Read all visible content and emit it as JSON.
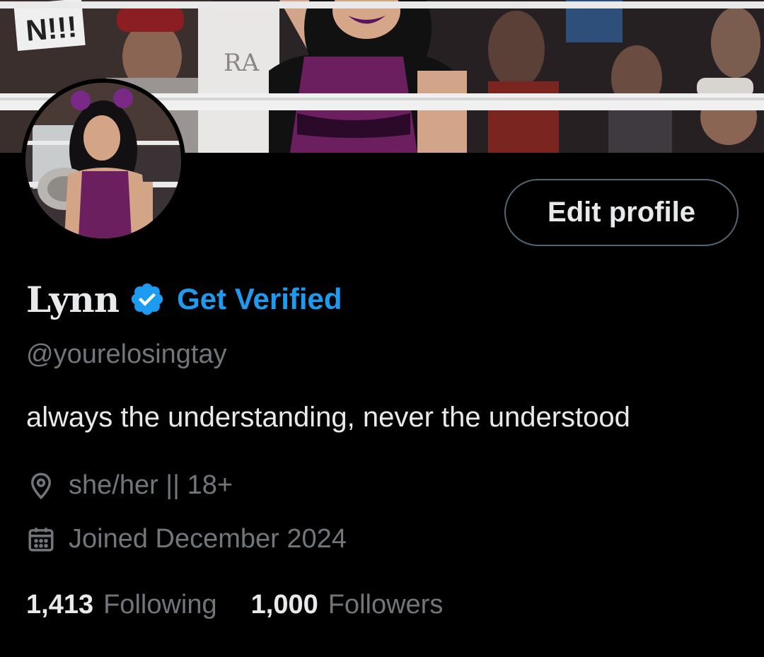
{
  "profile": {
    "display_name": "Lynn",
    "verified_icon": "verified-badge-icon",
    "get_verified_label": "Get Verified",
    "handle": "@yourelosingtay",
    "bio": "always the understanding, never the understood",
    "location": "she/her || 18+",
    "joined": "Joined December 2024",
    "edit_profile_label": "Edit profile"
  },
  "banner": {
    "sign_text": "N!!!"
  },
  "stats": {
    "following_count": "1,413",
    "following_label": "Following",
    "followers_count": "1,000",
    "followers_label": "Followers"
  },
  "icons": {
    "location": "location-pin-icon",
    "calendar": "calendar-icon"
  },
  "colors": {
    "background": "#000000",
    "accent": "#1d9bf0",
    "primary_text": "#e7e9ea",
    "secondary_text": "#71767b",
    "button_border": "#536471",
    "outfit_purple": "#6b1f5e"
  }
}
